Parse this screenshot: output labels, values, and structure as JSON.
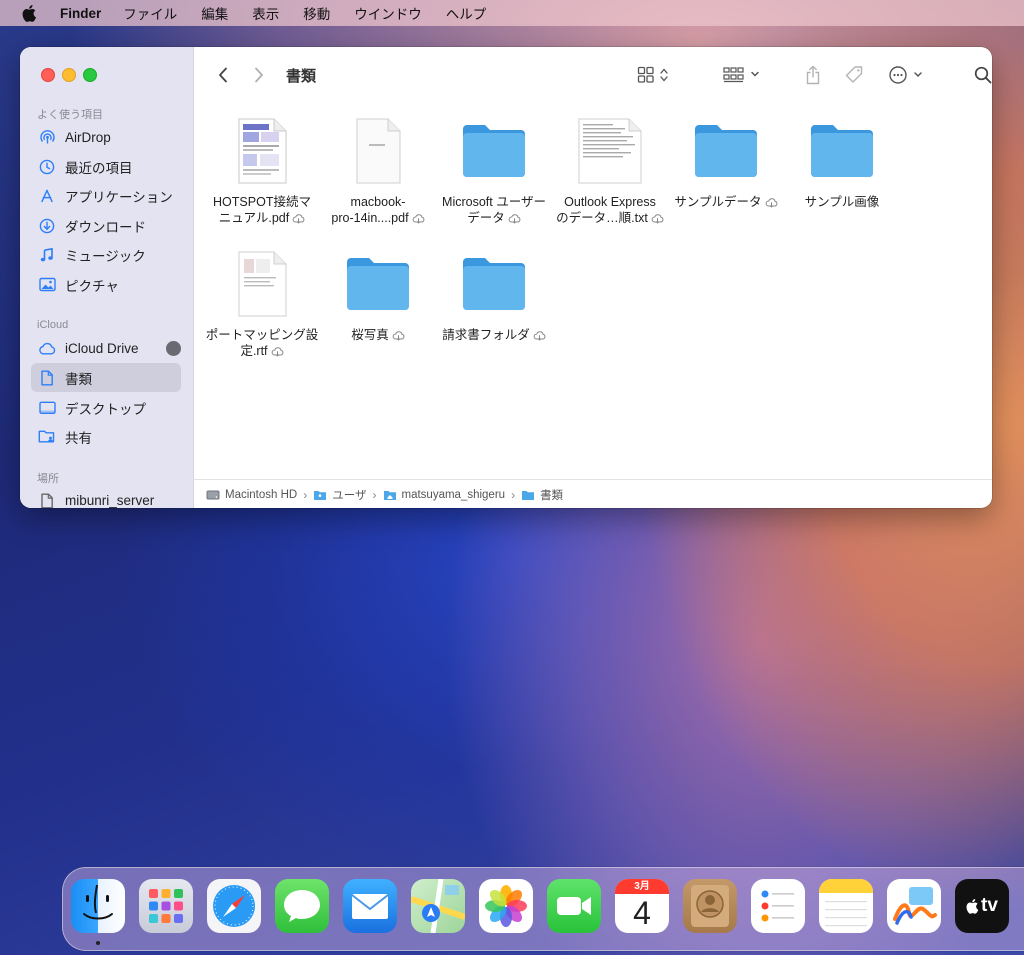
{
  "menubar": {
    "app_name": "Finder",
    "items": [
      "ファイル",
      "編集",
      "表示",
      "移動",
      "ウインドウ",
      "ヘルプ"
    ]
  },
  "sidebar": {
    "favorites_header": "よく使う項目",
    "favorites": [
      {
        "label": "AirDrop",
        "icon": "airdrop-icon"
      },
      {
        "label": "最近の項目",
        "icon": "clock-icon"
      },
      {
        "label": "アプリケーション",
        "icon": "applications-icon"
      },
      {
        "label": "ダウンロード",
        "icon": "download-icon"
      },
      {
        "label": "ミュージック",
        "icon": "music-icon"
      },
      {
        "label": "ピクチャ",
        "icon": "photo-icon"
      }
    ],
    "icloud_header": "iCloud",
    "icloud": [
      {
        "label": "iCloud Drive",
        "icon": "icloud-icon"
      },
      {
        "label": "書類",
        "icon": "document-icon",
        "selected": true
      },
      {
        "label": "デスクトップ",
        "icon": "desktop-icon"
      },
      {
        "label": "共有",
        "icon": "shared-folder-icon"
      }
    ],
    "locations_header": "場所",
    "locations": [
      {
        "label": "mibunri_server",
        "icon": "document-icon"
      }
    ]
  },
  "toolbar": {
    "title": "書類"
  },
  "files": [
    {
      "line1": "HOTSPOT接続マ",
      "line2": "ニュアル.pdf",
      "type": "pdf-colorful",
      "cloud": true
    },
    {
      "line1": "macbook-",
      "line2": "pro-14in....pdf",
      "type": "pdf-blank",
      "cloud": true
    },
    {
      "line1": "Microsoft ユーザー",
      "line2": "データ",
      "type": "folder",
      "cloud": true
    },
    {
      "line1": "Outlook Express",
      "line2": "のデータ…順.txt",
      "type": "txt",
      "cloud": true
    },
    {
      "line1": "サンプルデータ",
      "line2": "",
      "type": "folder",
      "cloud": true
    },
    {
      "line1": "サンプル画像",
      "line2": "",
      "type": "folder",
      "cloud": false
    },
    {
      "line1": "ポートマッピング設",
      "line2": "定.rtf",
      "type": "rtf",
      "cloud": true
    },
    {
      "line1": "桜写真",
      "line2": "",
      "type": "folder",
      "cloud": true
    },
    {
      "line1": "請求書フォルダ",
      "line2": "",
      "type": "folder",
      "cloud": true
    }
  ],
  "pathbar": [
    "Macintosh HD",
    "ユーザ",
    "matsuyama_shigeru",
    "書類"
  ],
  "dock": {
    "calendar_month": "3月",
    "calendar_day": "4",
    "tv_label": "tv",
    "apps": [
      "finder",
      "launchpad",
      "safari",
      "messages",
      "mail",
      "maps",
      "photos",
      "facetime",
      "calendar",
      "contacts",
      "reminders",
      "notes",
      "freeform",
      "apple-tv"
    ]
  },
  "colors": {
    "folder_blue": "#5fb4ec",
    "sidebar_bg": "#e4e3f1",
    "accent": "#0a7aff"
  }
}
